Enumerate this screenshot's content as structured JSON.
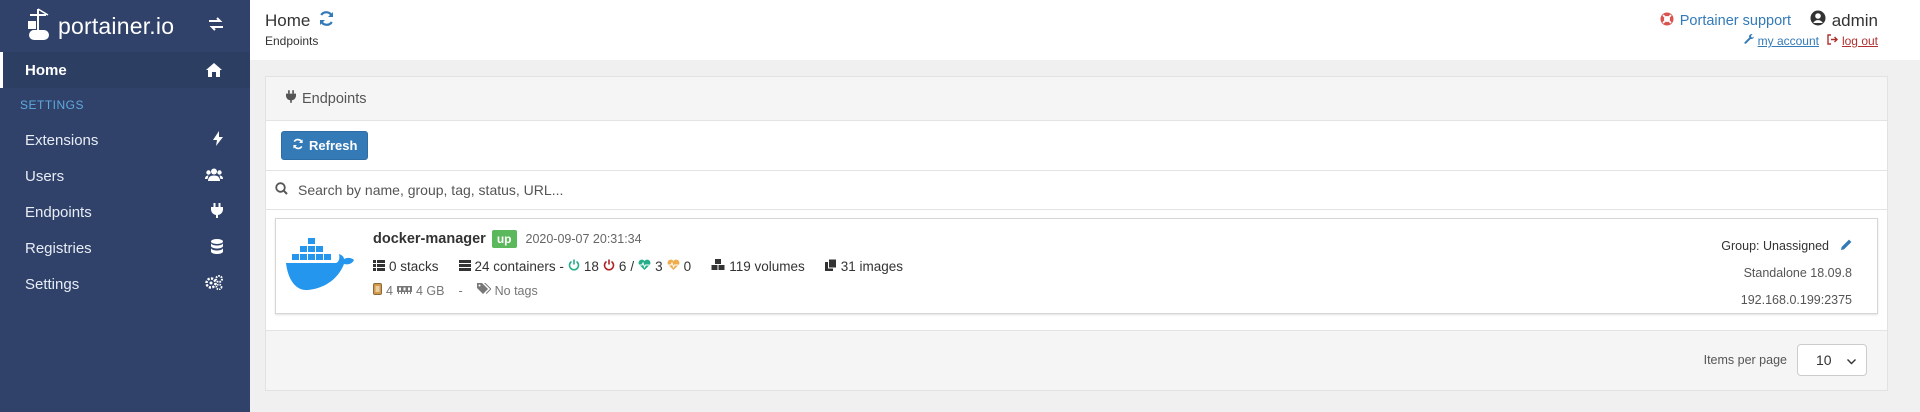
{
  "brand": {
    "name": "portainer.io"
  },
  "sidebar": {
    "home_label": "Home",
    "settings_heading": "SETTINGS",
    "items": [
      {
        "label": "Extensions",
        "icon": "bolt-icon"
      },
      {
        "label": "Users",
        "icon": "users-icon"
      },
      {
        "label": "Endpoints",
        "icon": "plug-icon"
      },
      {
        "label": "Registries",
        "icon": "database-icon"
      },
      {
        "label": "Settings",
        "icon": "cogs-icon"
      }
    ]
  },
  "header": {
    "title": "Home",
    "subtitle": "Endpoints",
    "support_label": "Portainer support",
    "username": "admin",
    "my_account": "my account",
    "log_out": "log out"
  },
  "panel": {
    "title": "Endpoints",
    "refresh_label": "Refresh",
    "search_placeholder": "Search by name, group, tag, status, URL..."
  },
  "endpoint": {
    "name": "docker-manager",
    "status": "up",
    "timestamp": "2020-09-07 20:31:34",
    "stacks": "0 stacks",
    "containers": "24 containers -",
    "running": "18",
    "stopped": "6",
    "slash": "/",
    "healthy": "3",
    "unhealthy": "0",
    "volumes": "119 volumes",
    "images": "31 images",
    "cpu": "4",
    "memory": "4 GB",
    "dash": "-",
    "tags": "No tags",
    "group": "Group: Unassigned",
    "engine": "Standalone 18.09.8",
    "url": "192.168.0.199:2375"
  },
  "pagination": {
    "items_per_page_label": "Items per page",
    "items_per_page_value": "10"
  },
  "colors": {
    "sidebar_bg": "#30426a",
    "accent": "#337ab7",
    "status_up": "#5cb85c",
    "running": "#23ae89",
    "stopped": "#ae2323",
    "unhealthy": "#f0ad4e",
    "docker_blue": "#2496ed"
  }
}
